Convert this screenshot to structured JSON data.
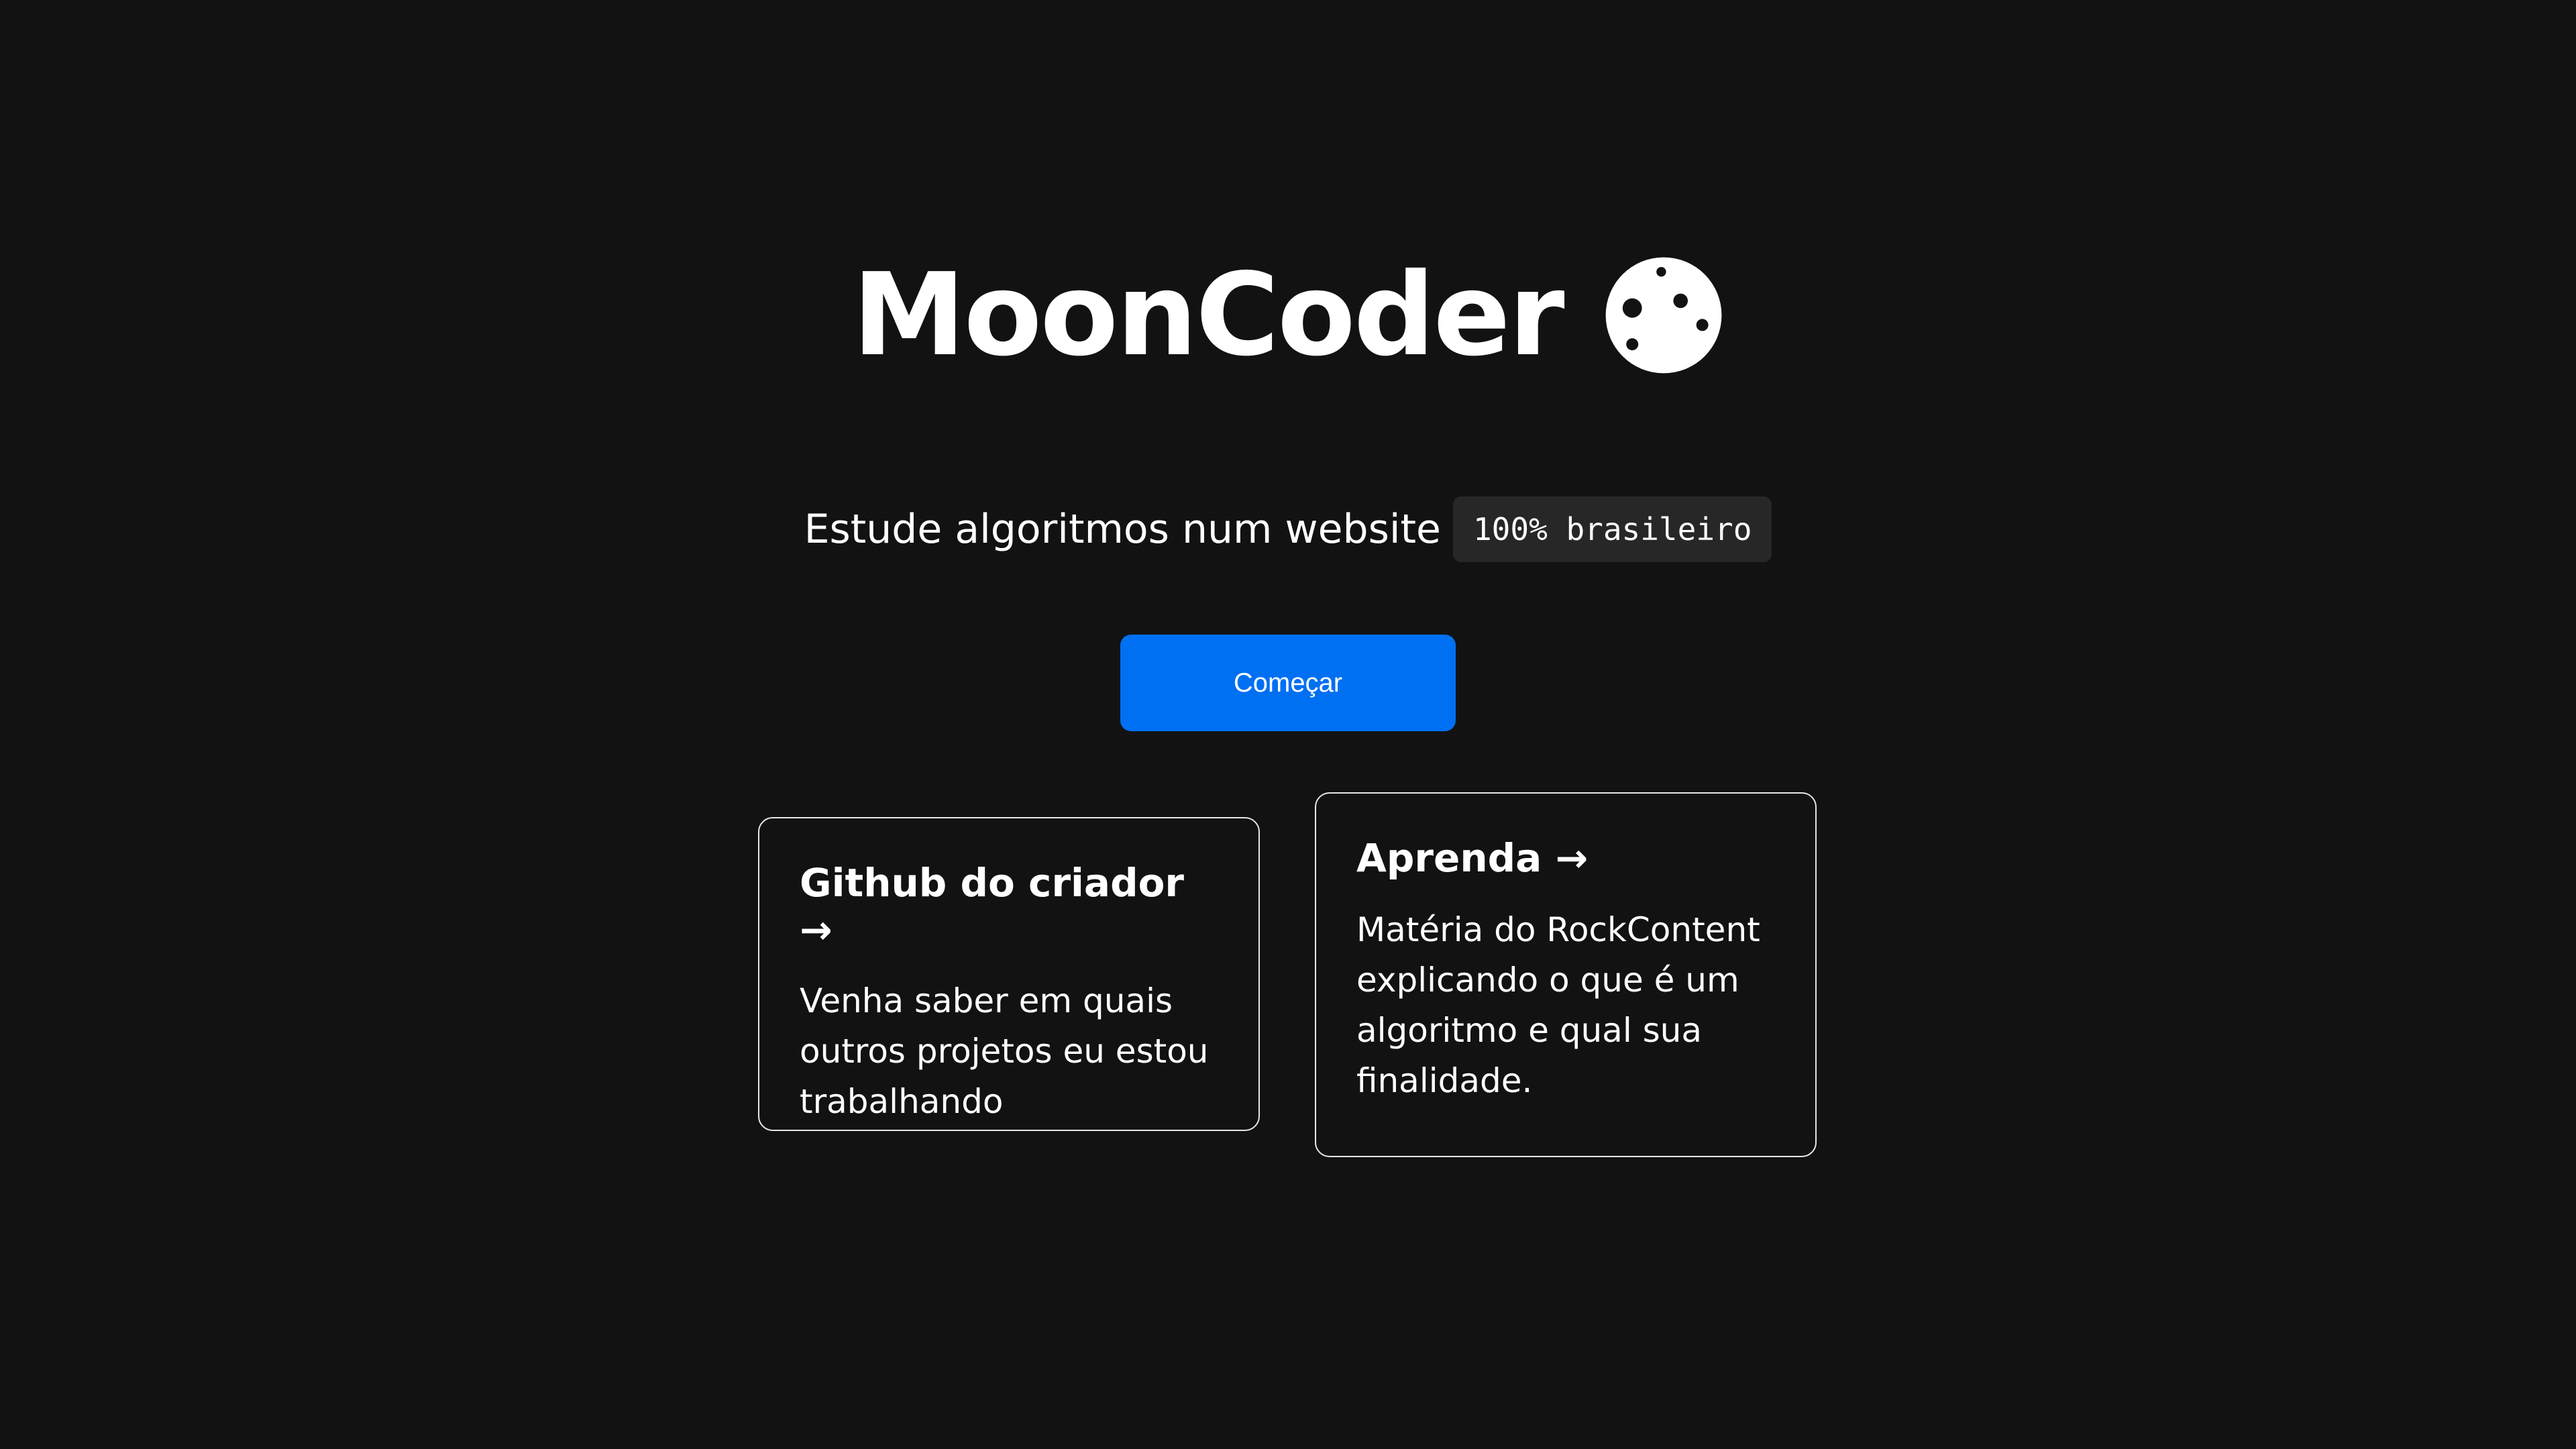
{
  "hero": {
    "title": "MoonCoder",
    "icon": "moon-icon"
  },
  "subtitle": {
    "text": "Estude algoritmos num website",
    "code": "100% brasileiro"
  },
  "cta": {
    "label": "Começar",
    "color": "#0070f3"
  },
  "cards": [
    {
      "title": "Github do criador →",
      "description": "Venha saber em quais outros projetos eu estou trabalhando"
    },
    {
      "title": "Aprenda →",
      "description": "Matéria do RockContent explicando o que é um algoritmo e qual sua finalidade."
    }
  ],
  "colors": {
    "background": "#121212",
    "text": "#ffffff",
    "code_background": "#272727",
    "card_border": "#e6e6e6"
  }
}
